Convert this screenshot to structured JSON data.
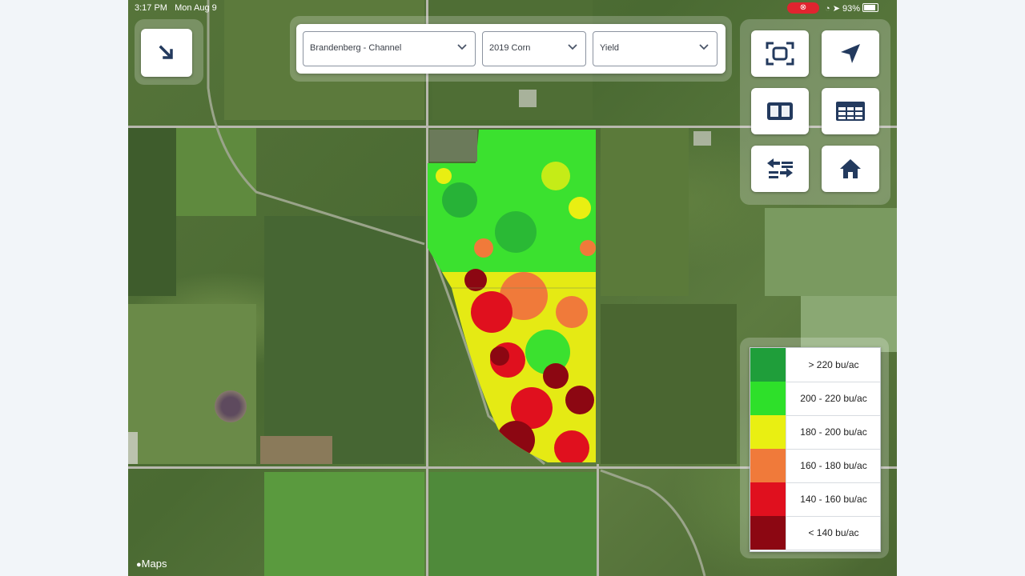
{
  "status_bar": {
    "time": "3:17 PM",
    "date": "Mon Aug 9",
    "recording_icon": "record-icon",
    "battery": "93%"
  },
  "selectors": {
    "field": "Brandenberg - Channel",
    "season": "2019 Corn",
    "layer": "Yield"
  },
  "legend": {
    "items": [
      {
        "label": "> 220 bu/ac",
        "color": "#1f9e3a"
      },
      {
        "label": "200 - 220 bu/ac",
        "color": "#2ee02a"
      },
      {
        "label": "180 - 200 bu/ac",
        "color": "#e9ef12"
      },
      {
        "label": "160 - 180 bu/ac",
        "color": "#f07a3a"
      },
      {
        "label": "140 - 160 bu/ac",
        "color": "#e0101e"
      },
      {
        "label": "< 140 bu/ac",
        "color": "#8c0712"
      }
    ]
  },
  "map": {
    "attribution": "Maps"
  },
  "icons": {
    "collapse": "arrow-down-right-icon",
    "fit": "fit-extent-icon",
    "locate": "location-arrow-icon",
    "compare": "split-view-icon",
    "table": "table-icon",
    "layers": "layers-list-icon",
    "home": "home-icon"
  }
}
